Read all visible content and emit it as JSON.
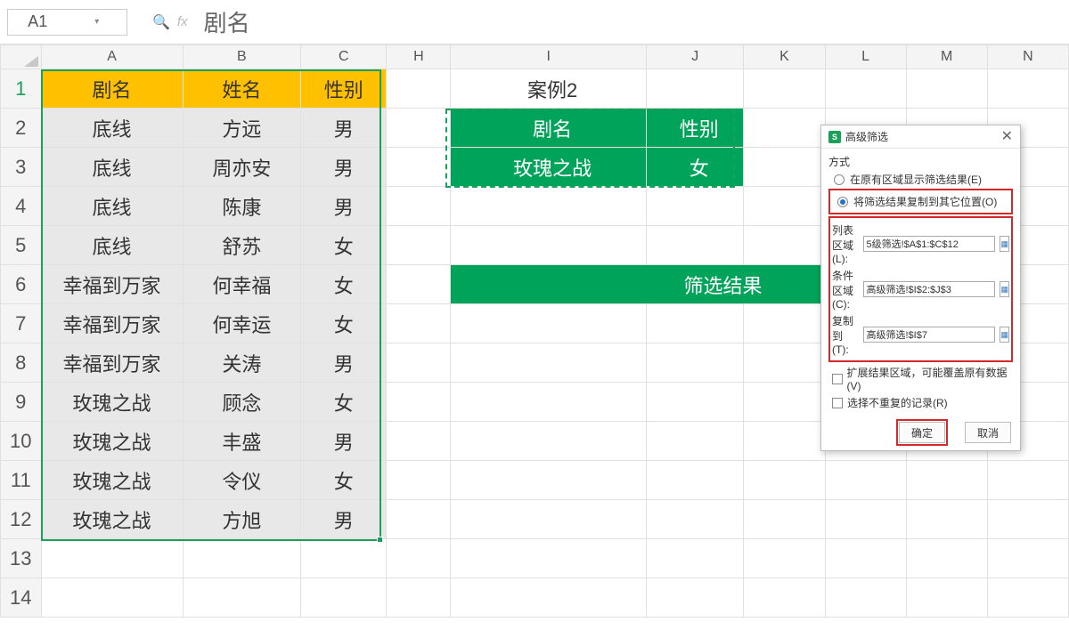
{
  "namebox": {
    "value": "A1"
  },
  "formula": {
    "fx": "fx",
    "value": "剧名"
  },
  "columns": [
    "A",
    "B",
    "C",
    "H",
    "I",
    "J",
    "K",
    "L",
    "M",
    "N"
  ],
  "rows": [
    "1",
    "2",
    "3",
    "4",
    "5",
    "6",
    "7",
    "8",
    "9",
    "10",
    "11",
    "12",
    "13",
    "14"
  ],
  "table": {
    "headers": [
      "剧名",
      "姓名",
      "性别"
    ],
    "rows": [
      [
        "底线",
        "方远",
        "男"
      ],
      [
        "底线",
        "周亦安",
        "男"
      ],
      [
        "底线",
        "陈康",
        "男"
      ],
      [
        "底线",
        "舒苏",
        "女"
      ],
      [
        "幸福到万家",
        "何幸福",
        "女"
      ],
      [
        "幸福到万家",
        "何幸运",
        "女"
      ],
      [
        "幸福到万家",
        "关涛",
        "男"
      ],
      [
        "玫瑰之战",
        "顾念",
        "女"
      ],
      [
        "玫瑰之战",
        "丰盛",
        "男"
      ],
      [
        "玫瑰之战",
        "令仪",
        "女"
      ],
      [
        "玫瑰之战",
        "方旭",
        "男"
      ]
    ]
  },
  "side": {
    "case_label": "案例2",
    "crit_hdr1": "剧名",
    "crit_hdr2": "性别",
    "crit_val1": "玫瑰之战",
    "crit_val2": "女",
    "result_label": "筛选结果"
  },
  "dialog": {
    "title": "高级筛选",
    "mode_label": "方式",
    "radio1": "在原有区域显示筛选结果(E)",
    "radio2": "将筛选结果复制到其它位置(O)",
    "list_label": "列表区域(L):",
    "list_value": "5级筛选!$A$1:$C$12",
    "crit_label": "条件区域(C):",
    "crit_value": "高级筛选!$I$2:$J$3",
    "copy_label": "复制到(T):",
    "copy_value": "高级筛选!$I$7",
    "check1": "扩展结果区域，可能覆盖原有数据(V)",
    "check2": "选择不重复的记录(R)",
    "ok": "确定",
    "cancel": "取消"
  }
}
